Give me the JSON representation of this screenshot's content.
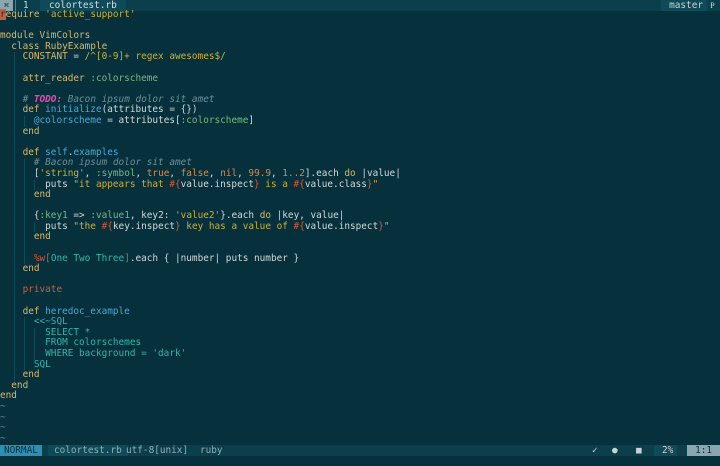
{
  "tabline": {
    "vim_icon": "vim-icon",
    "tab_number": "1",
    "tab_title": "colortest.rb",
    "branch": "master",
    "branch_icon_glyph": "Ᵽ"
  },
  "lines": [
    [
      "require ",
      "'active_support'"
    ],
    [
      ""
    ],
    [
      "module ",
      "VimColors"
    ],
    [
      "  class ",
      "RubyExample"
    ],
    [
      "    CONSTANT",
      " = ",
      "/^[0-9]+ regex awesomes$/"
    ],
    [
      ""
    ],
    [
      "    attr_reader",
      " :colorscheme"
    ],
    [
      ""
    ],
    [
      "    # ",
      "TODO:",
      " Bacon ipsum dolor sit amet"
    ],
    [
      "    def ",
      "initialize",
      "(attributes = {})"
    ],
    [
      "      @colorscheme",
      " = attributes[",
      ":colorscheme",
      "]"
    ],
    [
      "    end"
    ],
    [
      ""
    ],
    [
      "    def ",
      "self",
      ".",
      "examples"
    ],
    [
      "      # Bacon ipsum dolor sit amet"
    ],
    [
      "      [",
      "'string'",
      ", ",
      ":symbol",
      ", ",
      "true",
      ", ",
      "false",
      ", ",
      "nil",
      ", ",
      "99.9",
      ", ",
      "1..2",
      "].each ",
      "do",
      " |value|"
    ],
    [
      "        puts ",
      "\"it appears that ",
      "#{",
      "value.inspect",
      "}",
      " is a ",
      "#{",
      "value.class",
      "}",
      "\""
    ],
    [
      "      end"
    ],
    [
      ""
    ],
    [
      "      {",
      ":key1",
      " => ",
      ":value1",
      ", ",
      "key2:",
      " ",
      "'value2'",
      "}.each ",
      "do",
      " |key, value|"
    ],
    [
      "        puts ",
      "\"the ",
      "#{",
      "key.inspect",
      "}",
      " key has a value of ",
      "#{",
      "value.inspect",
      "}",
      "\""
    ],
    [
      "      end"
    ],
    [
      ""
    ],
    [
      "      ",
      "%w[",
      "One Two Three",
      "]",
      ".each { |number| puts number }"
    ],
    [
      "    end"
    ],
    [
      ""
    ],
    [
      "    private"
    ],
    [
      ""
    ],
    [
      "    def ",
      "heredoc_example"
    ],
    [
      "      <<~SQL"
    ],
    [
      "        SELECT *"
    ],
    [
      "        FROM colorschemes"
    ],
    [
      "        WHERE background = 'dark'"
    ],
    [
      "      SQL"
    ],
    [
      "    end"
    ],
    [
      "  end"
    ],
    [
      "end"
    ]
  ],
  "status": {
    "mode": "NORMAL",
    "filename": "colortest.rb",
    "encoding": "utf-8[unix]",
    "filetype": "ruby",
    "check_glyph": "✓",
    "dot_glyph": "●",
    "square_glyph": "■",
    "percent": "2%",
    "position": "1:1"
  },
  "colors": {
    "background": "#06313c",
    "mode_bg": "#2d8fb3",
    "accent_keyword": "#d8b86a",
    "accent_string": "#c9b03c",
    "accent_method": "#4aa8d6",
    "accent_todo": "#e24dad"
  }
}
